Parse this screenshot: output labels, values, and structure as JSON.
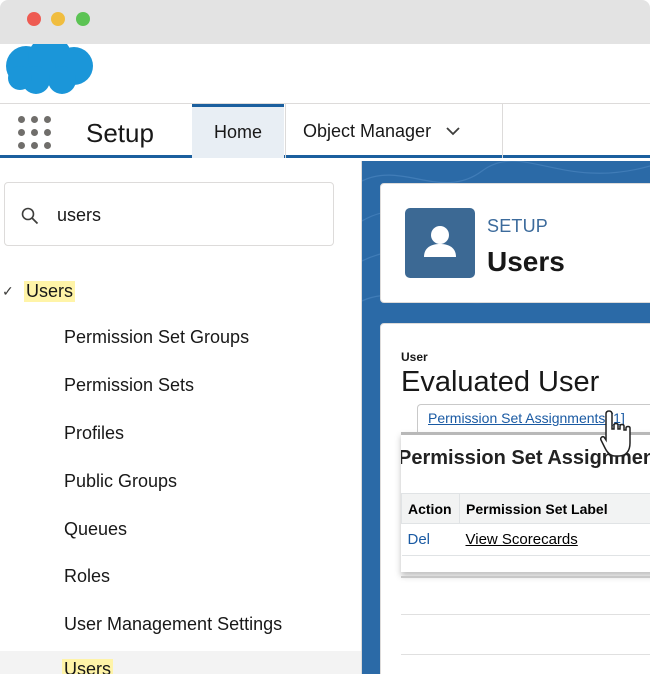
{
  "window": {
    "controls": [
      "close",
      "minimize",
      "maximize"
    ],
    "colors": {
      "close": "#ee5b52",
      "minimize": "#f0bd3f",
      "maximize": "#5cc354"
    }
  },
  "header": {
    "logo": "salesforce-cloud-logo",
    "logo_color": "#1b96d9"
  },
  "navbar": {
    "app_launcher_icon": "app-launcher-grid-icon",
    "app_title": "Setup",
    "tabs": [
      {
        "label": "Home",
        "active": true
      },
      {
        "label": "Object Manager",
        "icon": "chevron-down-icon"
      }
    ],
    "accent_color": "#1b5f9e"
  },
  "sidebar": {
    "search": {
      "value": "users",
      "placeholder": "",
      "icon": "search-icon"
    },
    "tree": {
      "parent_label": "Users",
      "expanded_icon": "check-icon",
      "items": [
        {
          "label": "Permission Set Groups"
        },
        {
          "label": "Permission Sets"
        },
        {
          "label": "Profiles"
        },
        {
          "label": "Public Groups"
        },
        {
          "label": "Queues"
        },
        {
          "label": "Roles"
        },
        {
          "label": "User Management Settings"
        },
        {
          "label": "Users",
          "selected": true
        }
      ]
    },
    "highlight_color": "#fff4a8"
  },
  "main": {
    "page_header": {
      "icon": "user-icon",
      "eyebrow": "SETUP",
      "title": "Users"
    },
    "overview": {
      "label": "User",
      "title": "Evaluated User",
      "tab_link": "Permission Set Assignments [1]",
      "related_list": {
        "title": "Permission Set Assignments",
        "columns": [
          "Action",
          "Permission Set Label"
        ],
        "rows": [
          {
            "action": "Del",
            "label": "View Scorecards"
          }
        ]
      }
    },
    "cursor": "hand-pointer-cursor"
  }
}
